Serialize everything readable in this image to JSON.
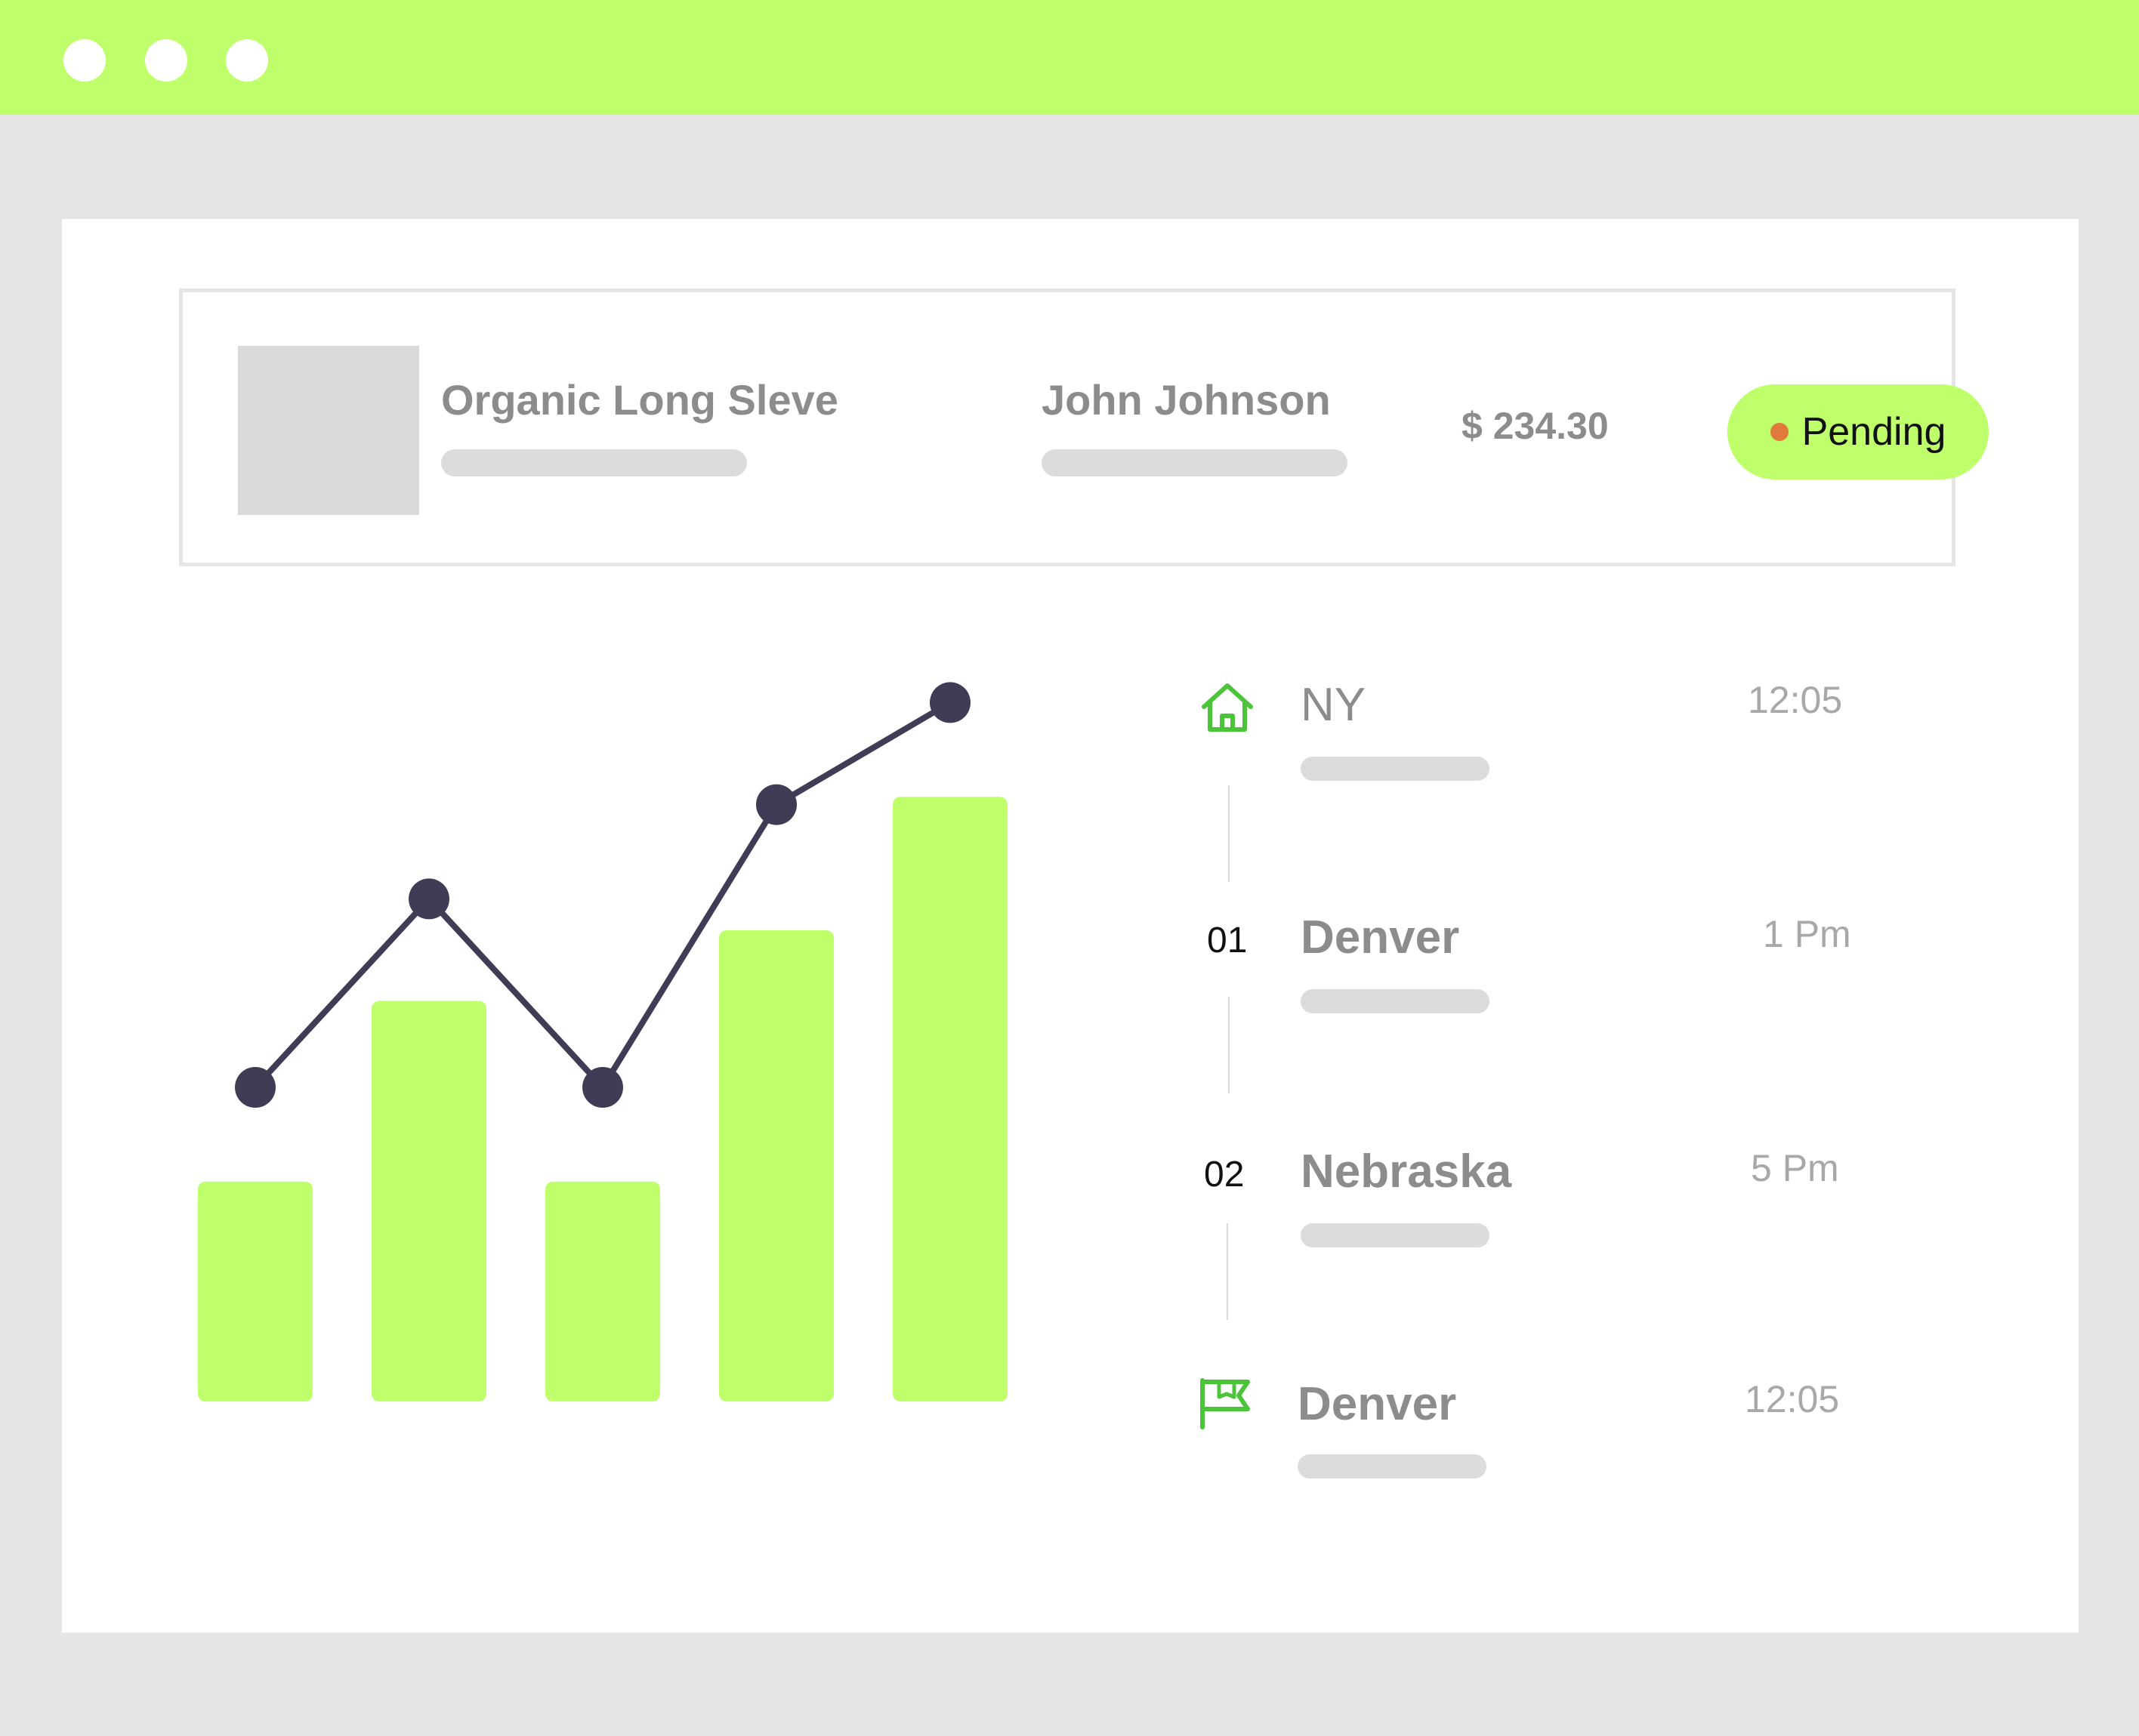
{
  "window": {
    "accent_color": "#bfff6b",
    "controls": [
      "window-dot",
      "window-dot",
      "window-dot"
    ]
  },
  "order": {
    "product_name": "Organic Long Sleve",
    "customer_name": "John Johnson",
    "price": "$ 234.30",
    "status": "Pending",
    "status_color": "#e07a3c"
  },
  "chart_data": {
    "type": "bar",
    "categories": [
      "",
      "",
      "",
      "",
      ""
    ],
    "series": [
      {
        "kind": "bar",
        "values": [
          28,
          51,
          28,
          60,
          77
        ],
        "color": "#bfff6b"
      },
      {
        "kind": "line",
        "values": [
          40,
          64,
          40,
          76,
          89
        ],
        "color": "#3f3d56"
      }
    ],
    "ylim": [
      0,
      100
    ],
    "grid": false,
    "axes_visible": false
  },
  "timeline": [
    {
      "marker_icon": "home-icon",
      "place": "NY",
      "time": "12:05"
    },
    {
      "marker": "01",
      "place": "Denver",
      "time": "1 Pm"
    },
    {
      "marker": "02",
      "place": "Nebraska",
      "time": "5 Pm"
    },
    {
      "marker_icon": "flag-icon",
      "place": "Denver",
      "time": "12:05"
    }
  ]
}
